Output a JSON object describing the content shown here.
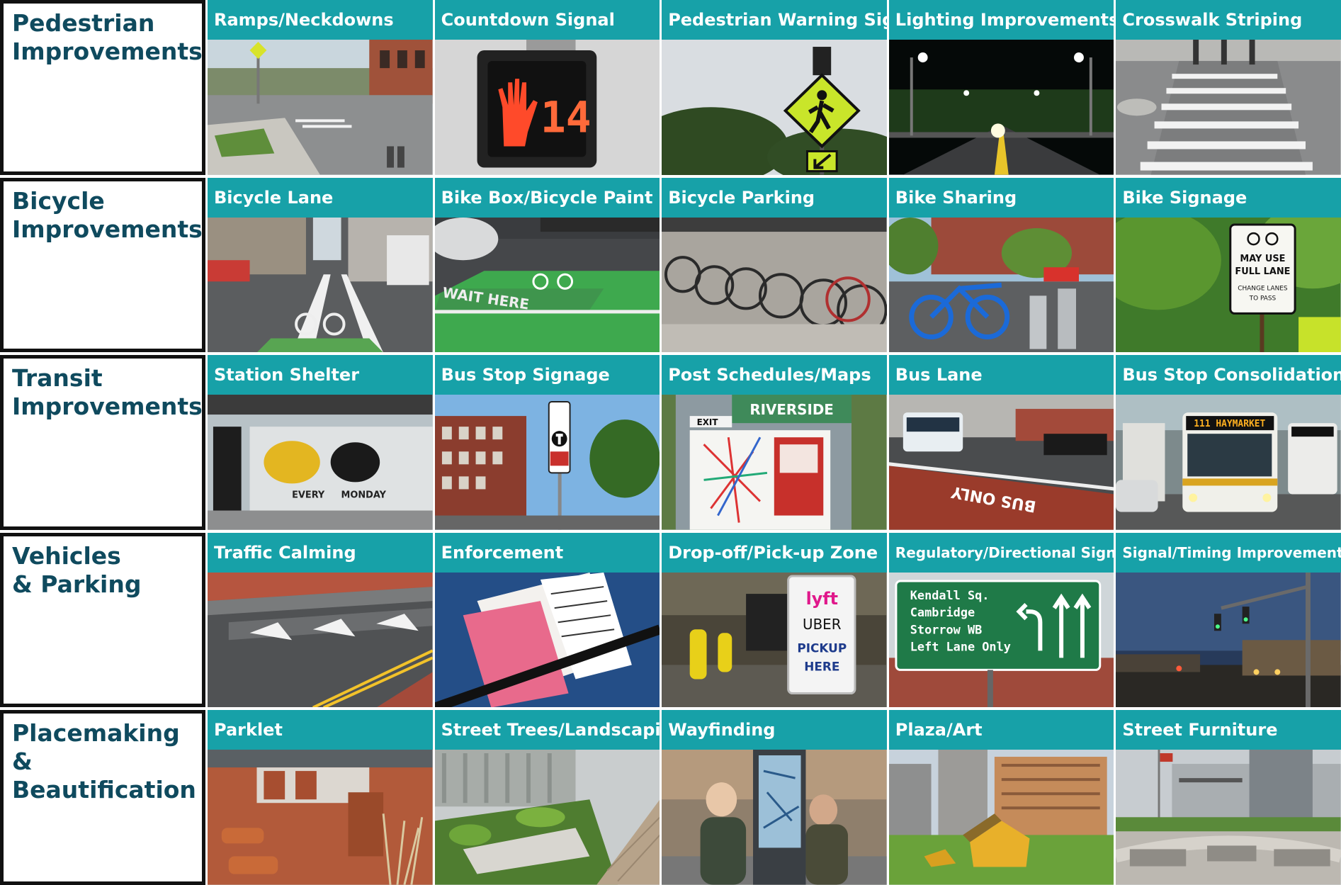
{
  "rows": [
    {
      "label_lines": [
        "Pedestrian",
        "Improvements"
      ],
      "cells": [
        {
          "title": "Ramps/Neckdowns",
          "icon": "curb-ramp-photo"
        },
        {
          "title": "Countdown Signal",
          "icon": "countdown-signal-photo",
          "signal_number": "14"
        },
        {
          "title": "Pedestrian Warning Signs",
          "icon": "pedestrian-warning-sign-photo"
        },
        {
          "title": "Lighting Improvements",
          "icon": "street-lighting-photo"
        },
        {
          "title": "Crosswalk Striping",
          "icon": "crosswalk-photo"
        }
      ]
    },
    {
      "label_lines": [
        "Bicycle",
        "Improvements"
      ],
      "cells": [
        {
          "title": "Bicycle Lane",
          "icon": "bicycle-lane-photo"
        },
        {
          "title": "Bike Box/Bicycle Paint",
          "icon": "bike-box-photo",
          "pavement_text": "WAIT HERE"
        },
        {
          "title": "Bicycle Parking",
          "icon": "bicycle-rack-photo"
        },
        {
          "title": "Bike Sharing",
          "icon": "bike-share-photo"
        },
        {
          "title": "Bike Signage",
          "icon": "bike-sign-photo",
          "sign_text": [
            "MAY USE",
            "FULL LANE",
            "CHANGE LANES",
            "TO PASS"
          ]
        }
      ]
    },
    {
      "label_lines": [
        "Transit",
        "Improvements"
      ],
      "cells": [
        {
          "title": "Station Shelter",
          "icon": "bus-shelter-photo",
          "ad_text": [
            "EVERY",
            "MONDAY"
          ]
        },
        {
          "title": "Bus Stop Signage",
          "icon": "bus-stop-sign-photo"
        },
        {
          "title": "Post Schedules/Maps",
          "icon": "transit-map-photo",
          "station_name": "RIVERSIDE",
          "exit_text": "EXIT"
        },
        {
          "title": "Bus Lane",
          "icon": "bus-lane-photo",
          "pavement_text": "BUS ONLY"
        },
        {
          "title": "Bus Stop Consolidation",
          "icon": "bus-photo",
          "destination_text": "111 HAYMARKET"
        }
      ]
    },
    {
      "label_lines": [
        "Vehicles",
        "& Parking"
      ],
      "cells": [
        {
          "title": "Traffic Calming",
          "icon": "speed-hump-photo"
        },
        {
          "title": "Enforcement",
          "icon": "parking-ticket-photo"
        },
        {
          "title": "Drop-off/Pick-up Zone",
          "icon": "rideshare-pickup-photo",
          "sign_text": [
            "lyft",
            "UBER",
            "PICKUP",
            "HERE"
          ]
        },
        {
          "title": "Regulatory/Directional Signs",
          "icon": "guide-sign-photo",
          "sign_text": [
            "Kendall Sq.",
            "Cambridge",
            "Storrow WB",
            "Left Lane Only"
          ]
        },
        {
          "title": "Signal/Timing Improvements",
          "icon": "traffic-signal-photo"
        }
      ]
    },
    {
      "label_lines": [
        "Placemaking",
        "& Beautification"
      ],
      "cells": [
        {
          "title": "Parklet",
          "icon": "parklet-photo"
        },
        {
          "title": "Street Trees/Landscaping",
          "icon": "landscaping-photo"
        },
        {
          "title": "Wayfinding",
          "icon": "wayfinding-kiosk-photo"
        },
        {
          "title": "Plaza/Art",
          "icon": "plaza-art-photo"
        },
        {
          "title": "Street Furniture",
          "icon": "street-furniture-photo"
        }
      ]
    }
  ],
  "colors": {
    "header_teal": "#17a1a8",
    "label_navy": "#0f4a5e",
    "frame_black": "#111111"
  }
}
